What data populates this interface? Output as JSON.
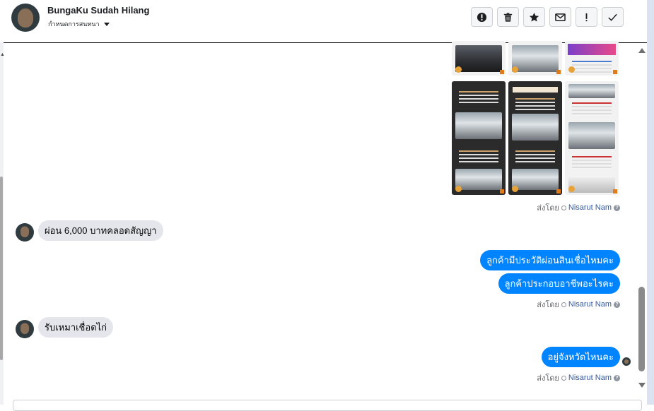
{
  "header": {
    "contact_name": "BungaKu Sudah Hilang",
    "subtitle": "กำหนดการสนทนา",
    "toolbar": [
      {
        "name": "spam-button",
        "icon": "alert-circle-icon"
      },
      {
        "name": "delete-button",
        "icon": "trash-icon"
      },
      {
        "name": "star-button",
        "icon": "star-icon"
      },
      {
        "name": "mark-unread-button",
        "icon": "envelope-icon"
      },
      {
        "name": "follow-up-button",
        "icon": "exclamation-icon"
      },
      {
        "name": "done-button",
        "icon": "check-icon"
      }
    ]
  },
  "conversation": {
    "sent_by_prefix": "ส่งโดย",
    "sender_name": "Nisarut Nam",
    "help_glyph": "?",
    "messages": [
      {
        "direction": "in",
        "text": "ผ่อน 6,000 บาทคลอดสัญญา"
      },
      {
        "direction": "out",
        "text": "ลูกค้ามีประวัติผ่อนสินเชื่อไหมคะ"
      },
      {
        "direction": "out",
        "text": "ลูกค้าประกอบอาชีพอะไรคะ"
      },
      {
        "direction": "in",
        "text": "รับเหมาเชื่อดไก่"
      },
      {
        "direction": "out",
        "text": "อยู่จังหวัดไหนคะ"
      }
    ]
  },
  "colors": {
    "outgoing_bubble": "#0084ff",
    "incoming_bubble": "#e4e6eb",
    "sender_link": "#385898"
  }
}
